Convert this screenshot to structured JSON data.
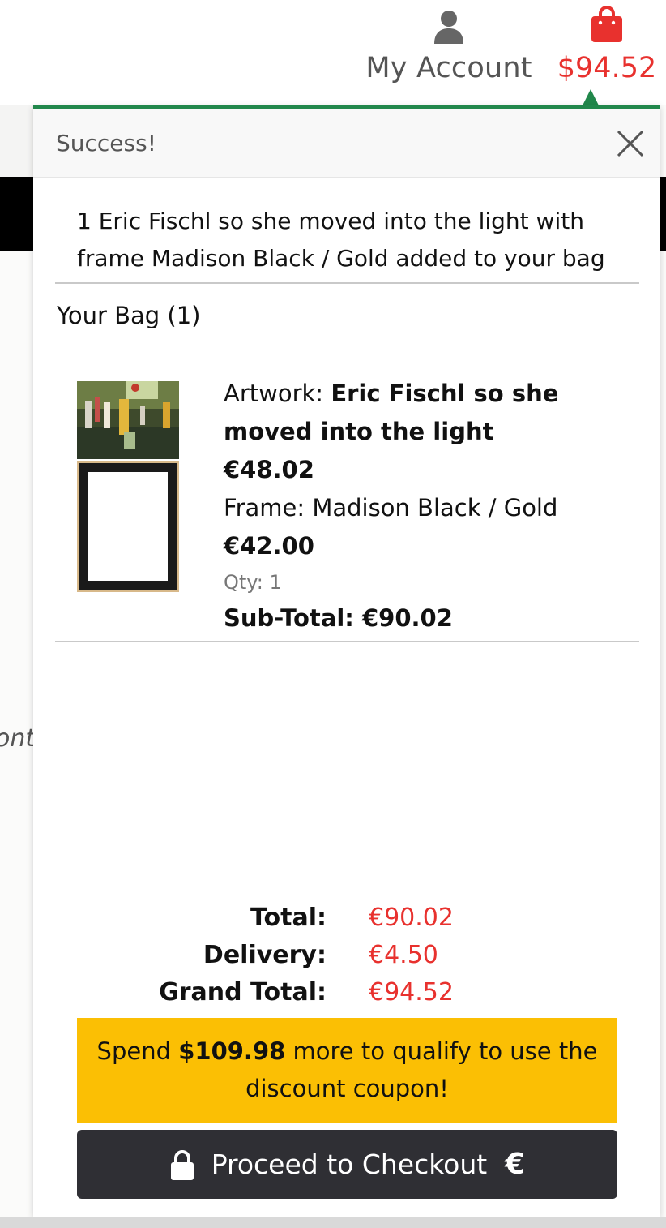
{
  "header": {
    "account_label": "My Account",
    "bag_total": "$94.52",
    "bag_color": "#e8312e"
  },
  "background": {
    "partial_text": "onte"
  },
  "popover": {
    "title": "Success!",
    "accent_color": "#21874b",
    "message": "1 Eric Fischl so she moved into the light with frame Madison Black / Gold added to your bag",
    "bag_heading": "Your Bag (1)",
    "item": {
      "artwork_label": "Artwork: ",
      "artwork_name": "Eric Fischl so she moved into the light",
      "artwork_price": "€48.02",
      "frame_text": "Frame: Madison Black / Gold",
      "frame_price": "€42.00",
      "qty": "Qty: 1",
      "subtotal": "Sub-Total: €90.02"
    },
    "totals": [
      {
        "label": "Total:",
        "value": "€90.02"
      },
      {
        "label": "Delivery:",
        "value": "€4.50"
      },
      {
        "label": "Grand Total:",
        "value": "€94.52"
      }
    ],
    "coupon": {
      "prefix": "Spend ",
      "amount": "$109.98",
      "suffix": " more to qualify to use the discount coupon!",
      "color": "#fbbf04"
    },
    "checkout": {
      "label": "Proceed to Checkout",
      "currency_symbol": "€"
    }
  },
  "icons": {
    "account": "person-icon",
    "bag": "shopping-bag-icon",
    "close": "close-icon",
    "lock": "lock-icon"
  }
}
